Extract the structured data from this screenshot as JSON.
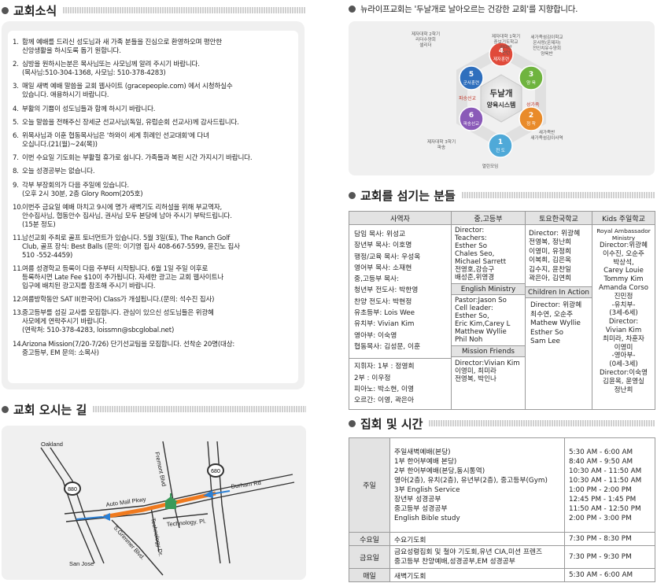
{
  "news": {
    "title": "교회소식",
    "items": [
      {
        "num": "1.",
        "text": "함께 예배를 드리신 성도님과 새 가족 분들을 진심으로 환영하오며 평안한\n신앙생활을 하시도록 돕기 원합니다."
      },
      {
        "num": "2.",
        "text": "심방을 원하시는분은 목사님또는 사모님께 알려 주시기 바랍니다.\n(목사님:510-304-1368, 사모님: 510-378-4283)"
      },
      {
        "num": "3.",
        "text": "매일 새벽 예배 말씀을 교회 웹사이트 (gracepeople.com) 에서 시청하실수\n있습니다. 애용하시기 바랍니다."
      },
      {
        "num": "4.",
        "text": "부활의 기쁨이 성도님들과 함께 하시기 바랍니다."
      },
      {
        "num": "5.",
        "text": "오늘 말씀을 전해주신 장세균 선교사님(독일, 유럽순회 선교사)께 감사드립니다."
      },
      {
        "num": "6.",
        "text": "위목사님과 이훈 협동목사님은 '하와이 세계 휘례인 선교대회'에 다녀\n오십니다.(21(월)~24(목))"
      },
      {
        "num": "7.",
        "text": "이번 수요일 기도회는 부활절 휴가로 쉽니다. 가족들과 복된 시간 가지시기 바랍니다."
      },
      {
        "num": "8.",
        "text": "오늘 성경공부는 없습니다."
      },
      {
        "num": "9.",
        "text": "각부 부장회의가 다음 주일에 있습니다.\n(오후 2시 30분, 2층 Glory Room(205호)"
      },
      {
        "num": "10.",
        "text": "이번주 금요일 예배 마치고 9시에 명가 새벽기도 리허설을 위해 부교역자,\n안수집사님, 협동안수 집사님, 권사님 모두 본당에 남아 주시기 부탁드립니다.\n(15분 정도)"
      },
      {
        "num": "11.",
        "text": "남선교회 주최로 골프 토너먼트가 있습니다. 5월 3일(토), The Ranch Golf\nClub, 골프 장식: Best Balls (문의: 이기영 집사 408-667-5599, 윤진노 집사\n510 -552-4459)"
      },
      {
        "num": "11.",
        "text": "여름 성경학교 등록이 다음 주부터 시작됩니다. 6월 1일 주일 이후로\n등록하시면 Late Fee $10이 추가됩니다. 자세한 광고는 교회 웹사이트나\n입구에 배치된 광고지를 참조해 주시기 바랍니다."
      },
      {
        "num": "12.",
        "text": "여름방학동안 SAT II(한국어) Class가 개설됩니다.(문의: 석수진 집사)"
      },
      {
        "num": "13.",
        "text": "중고등부를 섬길 교사를 모집합니다. 관심이 있으신 성도님들은 위광혜\n사모에게 연락주시기 바랍니다.\n(연락처: 510-378-4283, loissmn@sbcglobal.net)"
      },
      {
        "num": "14.",
        "text": "Arizona Mission(7/20-7/26) 단기선교팀을 모집합니다. 선착순 20명(대상:\n중고등부, EM 문의: 소목사)"
      }
    ]
  },
  "map": {
    "title": "교회 오시는 길",
    "labels": {
      "oakland": "Oakland",
      "san_jose": "San Jose",
      "fremont": "Fremont Blvd",
      "auto_mall": "Auto Mall Pkwy",
      "durham": "Durham Rd",
      "technology_dr": "Technology Dr.",
      "technology_pl": "Technology. Pl.",
      "grimmer": "S.Grimmer Blvd.",
      "hwy_880": "880",
      "hwy_680": "680"
    },
    "colors": {
      "route": "#f07a1e",
      "arrow": "#2a7fd4",
      "road": "#333333"
    }
  },
  "vision": {
    "motto": "뉴라이프교회는 '두날개로 날아오르는 건강한 교회'를 지향합니다.",
    "center_line1": "두날개",
    "center_line2": "양육시스템",
    "steps": [
      {
        "num": "1",
        "label": "전 도",
        "color": "#4fa9d8",
        "caption": "열린모임"
      },
      {
        "num": "2",
        "label": "정 착",
        "color": "#e98b2a",
        "caption": "새가족반\n새가족섬김이사역"
      },
      {
        "num": "3",
        "label": "양 육",
        "color": "#6fb43f",
        "caption": "세가족섬김이학교\n온사랑(온제자)\n전인치유수양회\n양육반"
      },
      {
        "num": "4",
        "label": "제자훈련",
        "color": "#e04a3a",
        "caption": "제자대학 1학기\n중보기도학교\n리더반\n인턴"
      },
      {
        "num": "5",
        "label": "군사훈련",
        "color": "#2f6fbd",
        "caption": "제자대학 2학기\n리더수양회\n셀리더"
      },
      {
        "num": "6",
        "label": "파송선교",
        "color": "#8a5ab8",
        "caption": "제자대학 3학기\n파송"
      }
    ],
    "ring_labels": {
      "left": "파송선교",
      "right": "성가족"
    }
  },
  "staff": {
    "title": "교회를 섬기는 분들",
    "headers": [
      "사역자",
      "중,고등부",
      "토요한국학교",
      "Kids 주일학교"
    ],
    "ministers": [
      "담임 목사: 위성교",
      "장년부 목사: 이호명",
      "행정/교육 목사: 우성옥",
      "영어부 목사: 소재현",
      "중,고등부 목사:",
      "청년부 전도사: 박한영",
      "찬양 전도사: 박현정",
      "유초등부: Lois Wee",
      "유치부: Vivian Kim",
      "영아부: 이숙영",
      "협동목사: 김성문, 이훈"
    ],
    "ministers_bottom": [
      "지휘자: 1부 : 정영희",
      "           2부 : 이우정",
      "피아노: 박소현, 이영",
      "오르간: 이영, 곽은아"
    ],
    "youth": [
      "Director:",
      "Teachers:",
      "Esther So",
      "Chales Seo,",
      "Michael Sarrett",
      "전영호,강승구",
      "배성준,위영경"
    ],
    "english_ministry": {
      "title": "English Ministry",
      "lines": [
        "Pastor:Jason So",
        "Cell leader:",
        "Esther So,",
        "Eric Kim,Carey L",
        "Matthew Wyllie",
        "Phil Noh"
      ]
    },
    "mission_friends": {
      "title": "Mission Friends",
      "lines": [
        "Director:Vivian Kim",
        "이영미, 최미라",
        "전영복, 박인나"
      ]
    },
    "saturday": [
      "Director: 위광혜",
      "전영복, 정난희",
      "이영미, 유정희",
      "이복희, 김은옥",
      "김수지, 윤찬일",
      "곽은아, 김연희"
    ],
    "children_in_action": {
      "title": "Children In Action",
      "lines": [
        "Director: 위광혜",
        "최수연, 오순주",
        "Mathew Wyllie",
        "Esther So",
        "Sam Lee"
      ]
    },
    "kids": [
      "Royal Ambassador",
      "Ministry",
      "Director:위광혜",
      "이수진, 오순주",
      "박상석,",
      "Carey Louie",
      "Tommy Kim",
      "Amanda Corso",
      "진민정",
      "-유치부-",
      "(3세-6세)",
      "Director:",
      "Vivian Kim",
      "최미라, 차훈자",
      "이영미",
      "-영아부-",
      "(0세-3세)",
      "Director:이숙영",
      "김윤옥, 윤영실",
      "정난희"
    ]
  },
  "schedule": {
    "title": "집회 및 시간",
    "sunday_label": "주일",
    "sunday_services": [
      "주일새벽예배(본당)",
      "1부 한어부예배 본당)",
      "2부 한어부예배(본당,동시통역)",
      "영아(2층), 유치(2층), 유년부(2층), 중고등부(Gym)",
      "3부 English Service",
      "장년부 성경공부",
      "중고등부 성경공부",
      "English Bible study"
    ],
    "sunday_times": [
      "5:30 AM - 6:00 AM",
      "8:40 AM - 9:50 AM",
      "10:30 AM - 11:50 AM",
      "10:30 AM - 11:50 AM",
      "1:00 PM - 2:00 PM",
      "12:45 PM - 1:45 PM",
      "11:50 AM - 12:50 PM",
      "2:00 PM -  3:00 PM"
    ],
    "wed_label": "수요일",
    "wed_service": "수요기도회",
    "wed_time": "7:30 PM - 8:30 PM",
    "fri_label": "금요일",
    "fri_services": [
      "금요성령집회 및 철야 기도회,유년 CIA,미션 프렌즈",
      "중고등부 찬양예배,성경공부,EM 성경공부"
    ],
    "fri_time": "7:30 PM - 9:30 PM",
    "daily_label": "매일",
    "daily_service": "새벽기도회",
    "daily_time": "5:30 AM - 6:00 AM"
  }
}
